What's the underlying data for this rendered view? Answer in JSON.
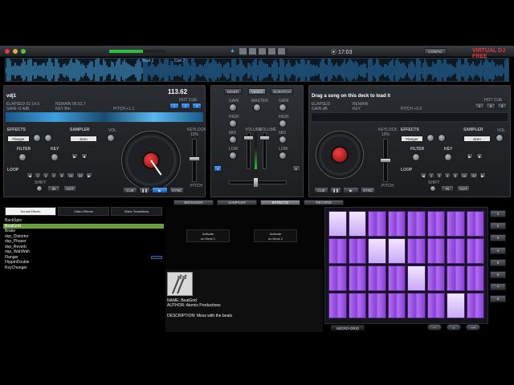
{
  "window": {
    "title": "VIRTUAL DJ FREE",
    "clock": "17:03",
    "config_label": "CONFIG"
  },
  "beats": {
    "beat1": "Beat 1",
    "cue2": "Cue 2"
  },
  "deck_left": {
    "name": "vdj1",
    "bpm": "113.62",
    "elapsed": "ELAPSED 01:14.5",
    "remain": "REMAIN 06:32.7",
    "gain": "GAIN:-0.4dB",
    "key": "KEY Bm",
    "pitch": "PITCH +1.1",
    "hotcue_label": "HOT CUE",
    "hotcues": [
      "1",
      "2",
      "3"
    ],
    "effects_label": "EFFECTS",
    "effect_value": "Flanger",
    "sampler_label": "SAMPLER",
    "sampler_value": "siren",
    "filter_label": "FILTER",
    "key_label": "KEY",
    "loop_label": "LOOP",
    "shift_label": "SHIFT",
    "in_label": "IN",
    "out_label": "OUT",
    "vol_label": "VOL",
    "loop_sizes": [
      "1",
      "2",
      "4",
      "8",
      "16",
      "32"
    ],
    "cue": "CUE",
    "play": "▶",
    "sync": "SYNC",
    "keylock_label": "KEYLOCK",
    "keylock_pct": "10%",
    "pitch_label": "PITCH"
  },
  "deck_right": {
    "drag_msg": "Drag a song on this deck to load it",
    "elapsed": "ELAPSED",
    "remain": "REMAIN",
    "gain": "GAIN dB",
    "key": "KEY",
    "pitch": "PITCH +0.0",
    "hotcue_label": "HOT CUE",
    "hotcues": [
      "1",
      "2",
      "3"
    ],
    "effects_label": "EFFECTS",
    "effect_value": "Flanger",
    "sampler_label": "SAMPLER",
    "sampler_value": "siren",
    "filter_label": "FILTER",
    "key_label": "KEY",
    "loop_label": "LOOP",
    "shift_label": "SHIFT",
    "in_label": "IN",
    "out_label": "OUT",
    "vol_label": "VOL",
    "loop_sizes": [
      "1",
      "2",
      "4",
      "8",
      "16",
      "32"
    ],
    "cue": "CUE",
    "play": "▶",
    "sync": "SYNC",
    "keylock_label": "KEYLOCK",
    "keylock_pct": "10%",
    "pitch_label": "PITCH"
  },
  "mixer": {
    "tabs": [
      "MIXER",
      "VIDEO",
      "SCRATCH"
    ],
    "gain": "GAIN",
    "master": "MASTER",
    "high": "HIGH",
    "mid": "MID",
    "low": "LOW",
    "volume": "VOLUME",
    "headphones": "HEADPHONES"
  },
  "browser_tabs": [
    "BROWSER",
    "SAMPLER",
    "EFFECTS",
    "RECORD"
  ],
  "active_browser_tab": "EFFECTS",
  "effects": {
    "subtabs": [
      "Sound Effects",
      "Video Effects",
      "Video Transitions"
    ],
    "items": [
      "BackSpin",
      "BeatGrid",
      "Brake",
      "dsp_Distortor",
      "dsp_Phaser",
      "dsp_Reverb",
      "dsp_WahWah",
      "Flanger",
      "FlippinDouble",
      "KeyChanger"
    ],
    "selected_index": 1,
    "activate_deck1": "Activate\non Deck 1",
    "activate_deck2": "Activate\non Deck 2",
    "info_name": "NAME: BeatGrid",
    "info_author": "AUTHOR: Atomix Productions",
    "info_desc": "DESCRIPTION: Mess with the beats"
  },
  "beatgrid": {
    "side_buttons": [
      "1",
      "2",
      "3",
      "4",
      "5",
      "6",
      "7",
      "8"
    ],
    "footer_label": "MICRO-GRID"
  }
}
